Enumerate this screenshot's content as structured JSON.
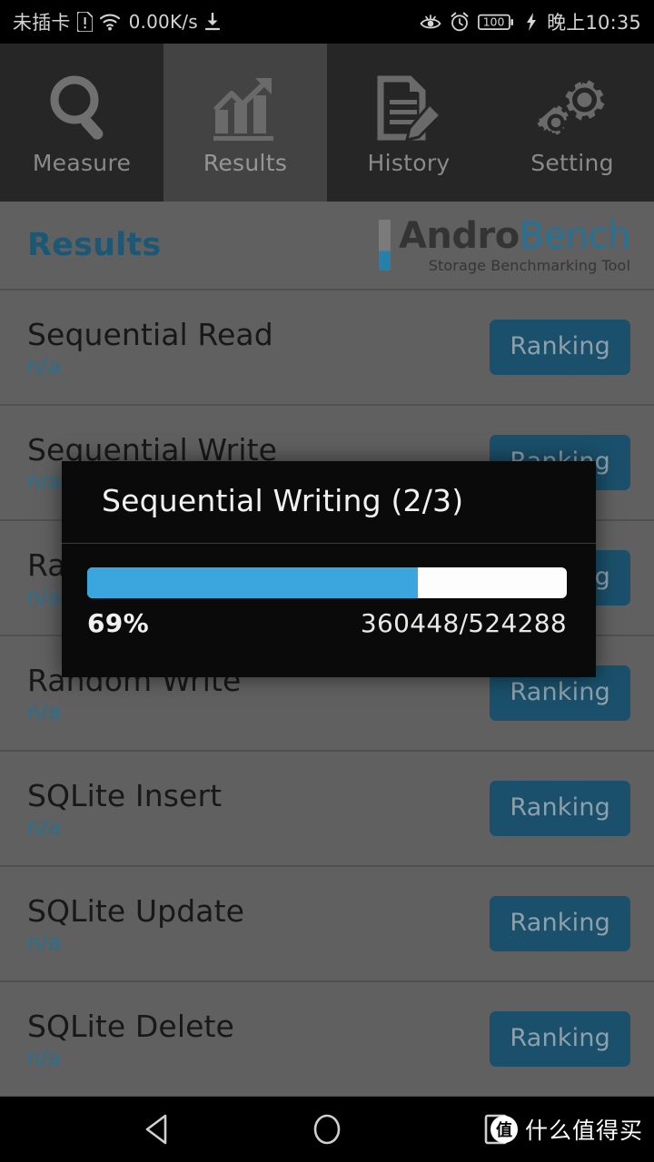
{
  "statusbar": {
    "carrier": "未插卡",
    "sim_icon": "sim-alert-icon",
    "wifi_icon": "wifi-icon",
    "network_speed": "0.00K/s",
    "download_icon": "download-icon",
    "eye_comfort_icon": "eye-comfort-icon",
    "alarm_icon": "alarm-clock-icon",
    "battery_level": "100",
    "charging_icon": "charging-bolt-icon",
    "time": "晚上10:35"
  },
  "tabs": [
    {
      "label": "Measure",
      "icon": "magnifier-icon",
      "selected": false
    },
    {
      "label": "Results",
      "icon": "bar-chart-icon",
      "selected": true
    },
    {
      "label": "History",
      "icon": "document-pencil-icon",
      "selected": false
    },
    {
      "label": "Setting",
      "icon": "gears-icon",
      "selected": false
    }
  ],
  "header": {
    "title": "Results",
    "logo_primary": "Andro",
    "logo_secondary": "Bench",
    "logo_tagline": "Storage Benchmarking Tool"
  },
  "list": {
    "ranking_label": "Ranking",
    "rows": [
      {
        "title": "Sequential Read",
        "value": "n/a"
      },
      {
        "title": "Sequential Write",
        "value": "n/a"
      },
      {
        "title": "Random Read",
        "value": "n/a"
      },
      {
        "title": "Random Write",
        "value": "n/a"
      },
      {
        "title": "SQLite Insert",
        "value": "n/a"
      },
      {
        "title": "SQLite Update",
        "value": "n/a"
      },
      {
        "title": "SQLite Delete",
        "value": "n/a"
      }
    ]
  },
  "dialog": {
    "title": "Sequential Writing (2/3)",
    "percent_label": "69%",
    "percent_value": 69,
    "count_label": "360448/524288"
  },
  "navbar": {
    "back_icon": "back-triangle-icon",
    "home_icon": "home-circle-icon",
    "recents_icon": "recents-square-icon",
    "watermark_badge": "值",
    "watermark_text": "什么值得买"
  },
  "colors": {
    "accent_blue": "#1d6384",
    "ranking_button": "#1d5a78",
    "progress_fill": "#3aa6dd",
    "list_background": "#6b6b6b",
    "tab_selected": "#4b4b4b",
    "tab_unselected": "#2b2b2b",
    "dialog_background": "#0a0a0a"
  }
}
